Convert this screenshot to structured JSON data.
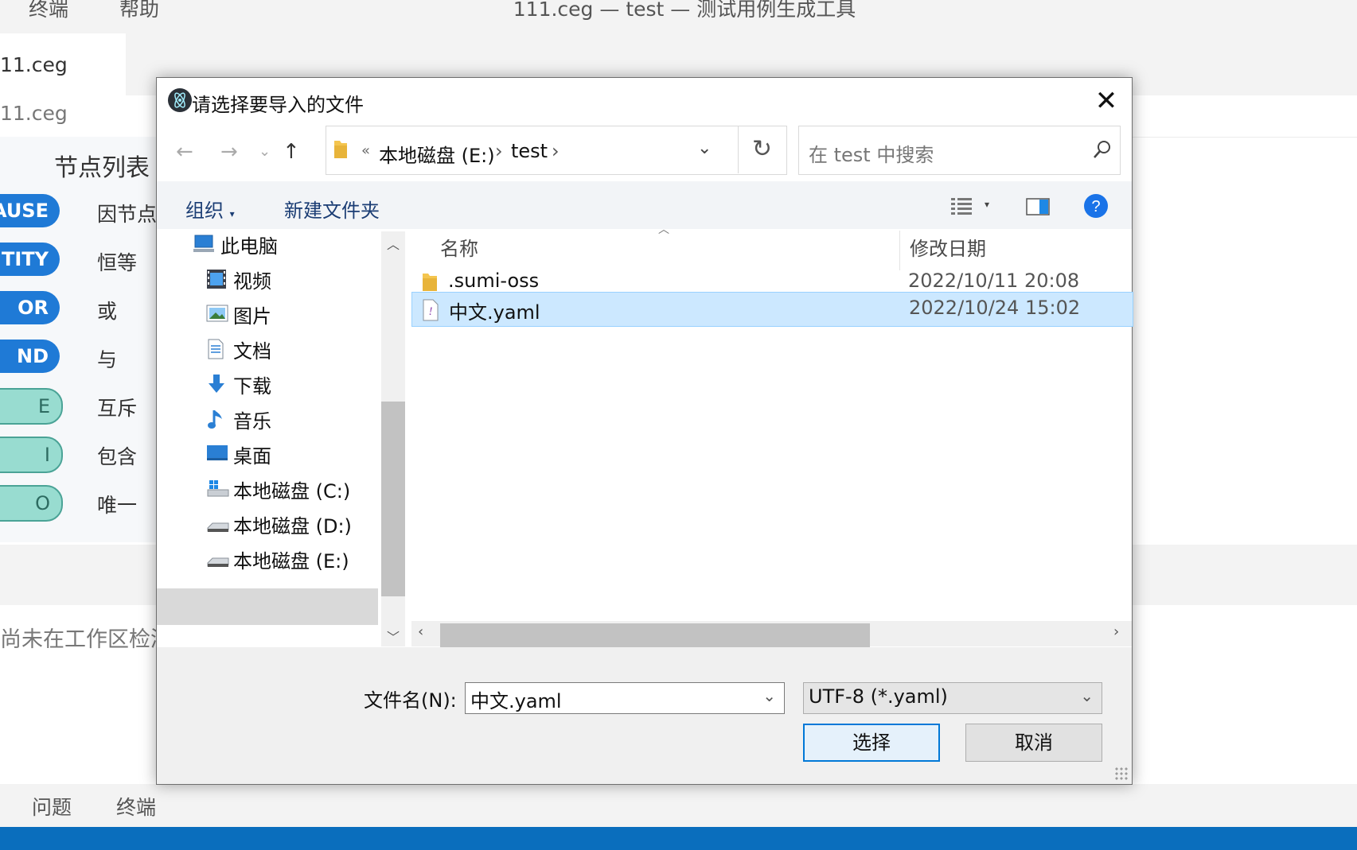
{
  "app": {
    "menu": [
      "终端",
      "帮助"
    ],
    "window_title": "111.ceg — test — 测试用例生成工具",
    "active_tab": "11.ceg",
    "breadcrumb": "11.ceg",
    "panel_title": "节点列表",
    "nodes": [
      {
        "chip": "AUSE",
        "label": "因节点",
        "style": "blue"
      },
      {
        "chip": "NTITY",
        "label": "恒等",
        "style": "blue"
      },
      {
        "chip": "OR",
        "label": "或",
        "style": "blue"
      },
      {
        "chip": "ND",
        "label": "与",
        "style": "blue"
      },
      {
        "chip": "E",
        "label": "互斥",
        "style": "teal"
      },
      {
        "chip": "I",
        "label": "包含",
        "style": "teal"
      },
      {
        "chip": "O",
        "label": "唯一",
        "style": "teal"
      }
    ],
    "workspace_message": "尚未在工作区检测",
    "bottom_tabs": [
      "问题",
      "终端"
    ]
  },
  "dialog": {
    "title": "请选择要导入的文件",
    "address": {
      "overflow": "«",
      "path": [
        "本地磁盘 (E:)",
        "test"
      ]
    },
    "search_placeholder": "在 test 中搜索",
    "toolbar": {
      "organize": "组织",
      "new_folder": "新建文件夹"
    },
    "nav_items": [
      {
        "label": "此电脑",
        "icon": "pc-icon"
      },
      {
        "label": "视频",
        "icon": "video-icon"
      },
      {
        "label": "图片",
        "icon": "pictures-icon"
      },
      {
        "label": "文档",
        "icon": "documents-icon"
      },
      {
        "label": "下载",
        "icon": "download-icon"
      },
      {
        "label": "音乐",
        "icon": "music-icon"
      },
      {
        "label": "桌面",
        "icon": "desktop-icon"
      },
      {
        "label": "本地磁盘 (C:)",
        "icon": "windows-drive-icon"
      },
      {
        "label": "本地磁盘 (D:)",
        "icon": "drive-icon"
      },
      {
        "label": "本地磁盘 (E:)",
        "icon": "drive-icon",
        "selected": true
      }
    ],
    "columns": {
      "name": "名称",
      "modified": "修改日期"
    },
    "files": [
      {
        "name": ".sumi-oss",
        "modified": "2022/10/11 20:08",
        "type": "folder",
        "selected": false
      },
      {
        "name": "中文.yaml",
        "modified": "2022/10/24 15:02",
        "type": "yaml",
        "selected": true
      }
    ],
    "filename_label": "文件名(N):",
    "filename_value": "中文.yaml",
    "filter_value": "UTF-8 (*.yaml)",
    "buttons": {
      "select": "选择",
      "cancel": "取消"
    },
    "colors": {
      "selection": "#cce8ff",
      "accent": "#0078d7",
      "status_bar": "#0a6ebd"
    }
  }
}
